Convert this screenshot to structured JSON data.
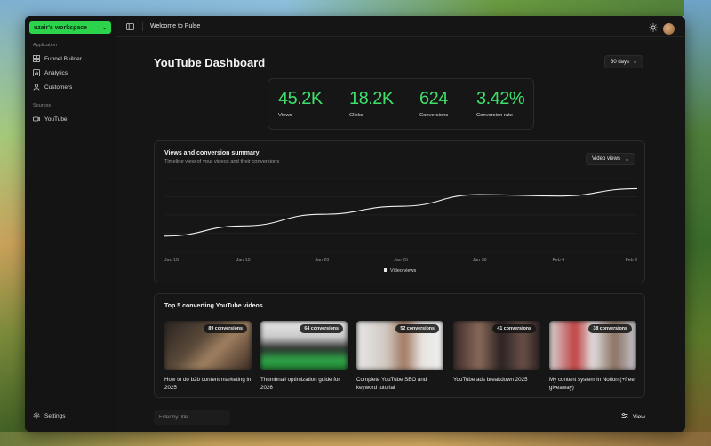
{
  "sidebar": {
    "workspace": "uzair's workspace",
    "section_application": "Application",
    "items": [
      {
        "label": "Funnel Builder",
        "icon": "funnel-builder-icon"
      },
      {
        "label": "Analytics",
        "icon": "analytics-icon"
      },
      {
        "label": "Customers",
        "icon": "user-icon"
      }
    ],
    "section_sources": "Sources",
    "sources": [
      {
        "label": "YouTube",
        "icon": "youtube-icon"
      }
    ],
    "settings": "Settings"
  },
  "topbar": {
    "heading": "Welcome to Pulse"
  },
  "dashboard": {
    "title": "YouTube Dashboard",
    "range": "30 days",
    "stats": [
      {
        "value": "45.2K",
        "label": "Views"
      },
      {
        "value": "18.2K",
        "label": "Clicks"
      },
      {
        "value": "624",
        "label": "Conversions"
      },
      {
        "value": "3.42%",
        "label": "Conversion rate"
      }
    ],
    "stat_color": "#3ee06a"
  },
  "summary": {
    "title": "Views and conversion summary",
    "subtitle": "Timeline view of your videos and their conversions",
    "metric": "Video views"
  },
  "chart_data": {
    "type": "line",
    "x": [
      "Jan 10",
      "Jan 15",
      "Jan 20",
      "Jan 25",
      "Jan 30",
      "Feb 4",
      "Feb 9"
    ],
    "series": [
      {
        "name": "Video views",
        "values": [
          0.21,
          0.35,
          0.51,
          0.62,
          0.78,
          0.76,
          0.86
        ]
      }
    ],
    "legend": "bottom-center",
    "grid": true
  },
  "top5": {
    "title": "Top 5 converting YouTube videos",
    "videos": [
      {
        "badge": "89 conversions",
        "title": "How to do b2b content marketing in 2025"
      },
      {
        "badge": "64 conversions",
        "title": "Thumbnail optimization guide for 2026"
      },
      {
        "badge": "52 conversions",
        "title": "Complete YouTube SEO and keyword tutorial"
      },
      {
        "badge": "41 conversions",
        "title": "YouTube ads breakdown 2025"
      },
      {
        "badge": "38 conversions",
        "title": "My content system in Notion (+free giveaway)"
      }
    ]
  },
  "bottombar": {
    "filter_placeholder": "Filter by title...",
    "view": "View"
  }
}
